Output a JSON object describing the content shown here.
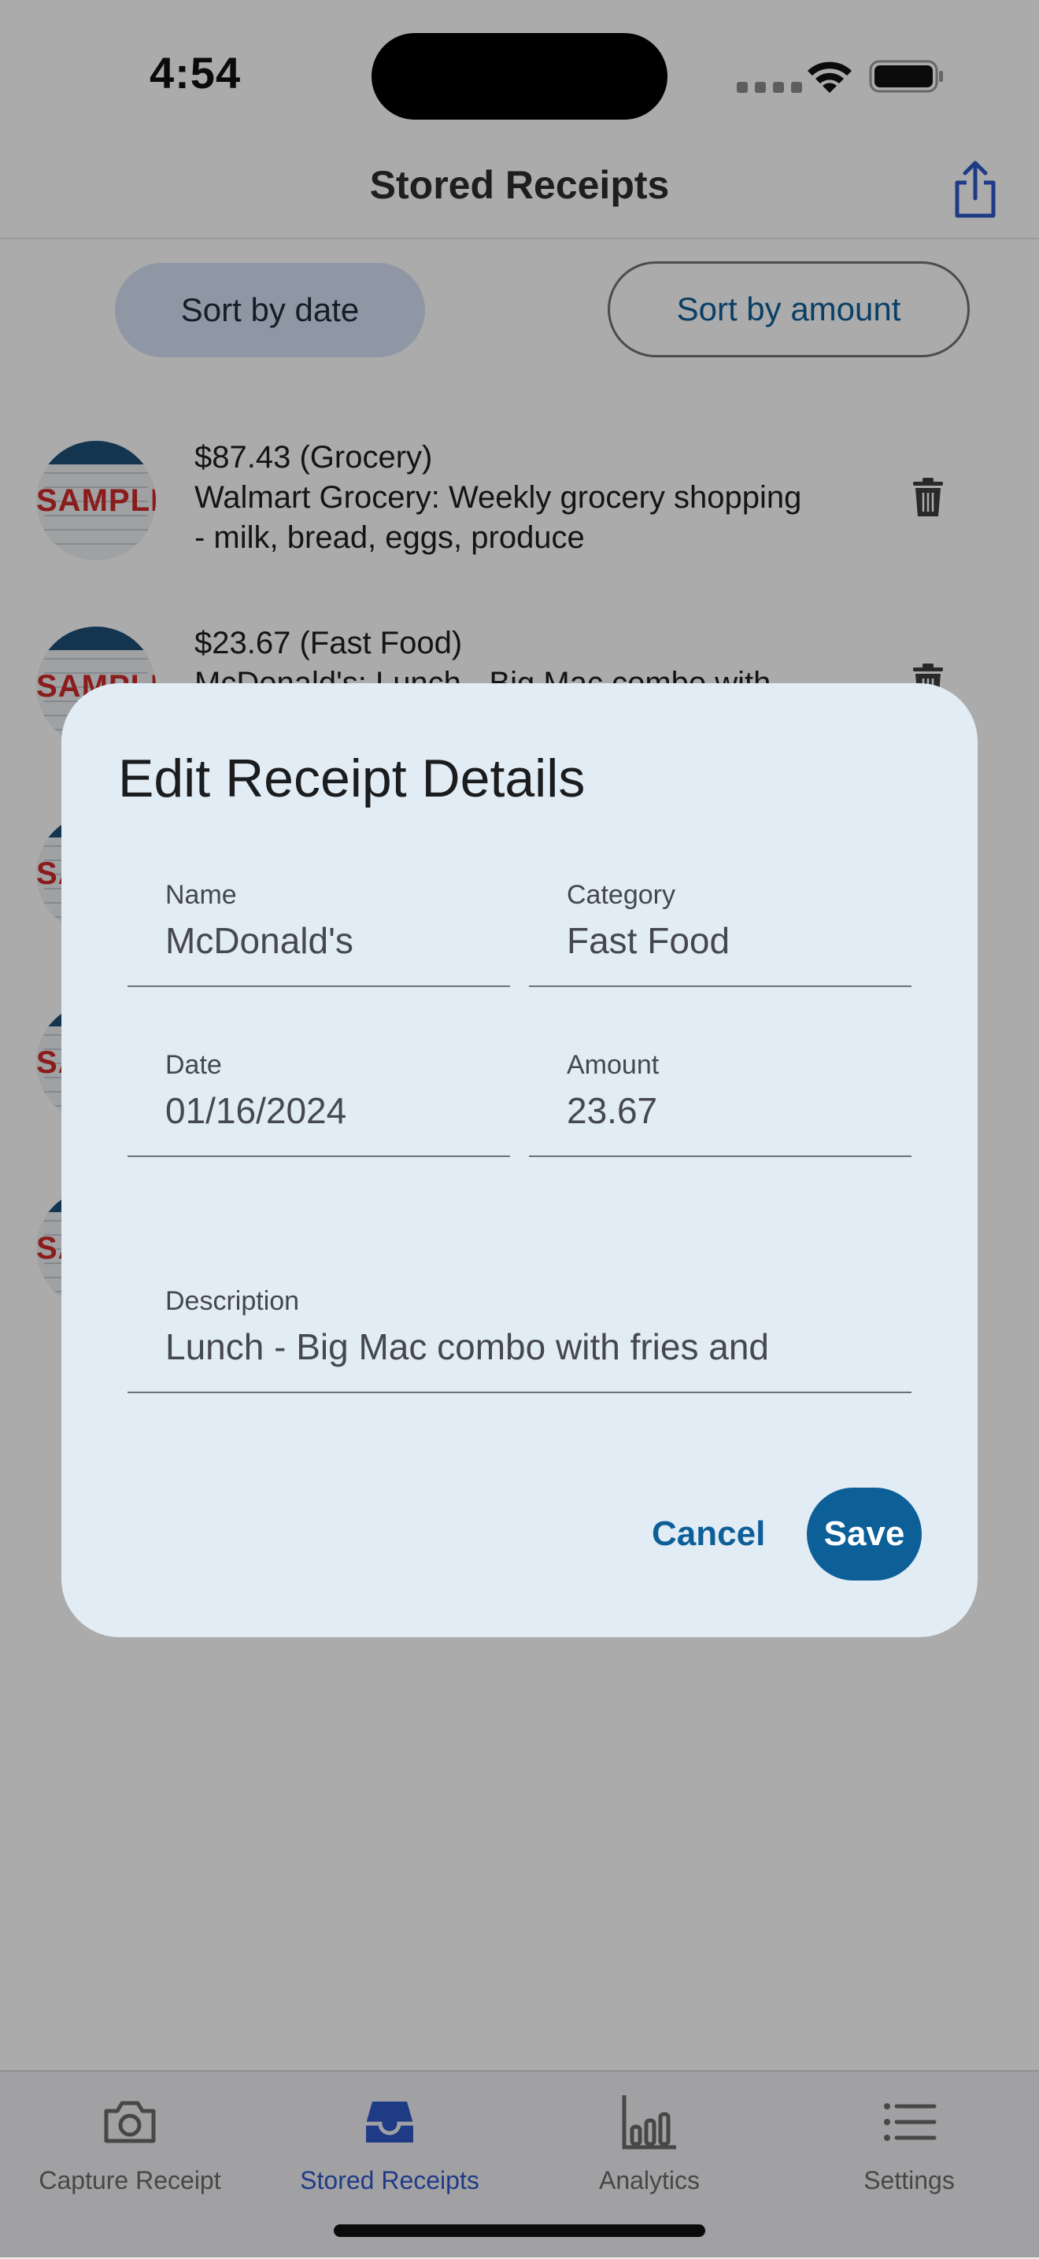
{
  "status_bar": {
    "time": "4:54"
  },
  "header": {
    "title": "Stored Receipts"
  },
  "sort": {
    "by_date_label": "Sort by date",
    "by_amount_label": "Sort by amount"
  },
  "receipts": [
    {
      "stamp": "SAMPLE",
      "line1": "$87.43 (Grocery)",
      "line2": "Walmart Grocery: Weekly grocery shopping",
      "line3": "- milk, bread, eggs, produce"
    },
    {
      "stamp": "SAMPLE",
      "line1": "$23.67 (Fast Food)",
      "line2": "McDonald's: Lunch - Big Mac combo with"
    },
    {
      "stamp": "SAMPLE"
    },
    {
      "stamp": "SAMPLE"
    },
    {
      "stamp": "SAMPLE"
    }
  ],
  "dialog": {
    "title": "Edit Receipt Details",
    "name_label": "Name",
    "name_value": "McDonald's",
    "category_label": "Category",
    "category_value": "Fast Food",
    "date_label": "Date",
    "date_value": "01/16/2024",
    "amount_label": "Amount",
    "amount_value": "23.67",
    "description_label": "Description",
    "description_value": "Lunch - Big Mac combo with fries and",
    "cancel_label": "Cancel",
    "save_label": "Save"
  },
  "nav": {
    "items": [
      {
        "label": "Capture Receipt",
        "icon": "camera-icon"
      },
      {
        "label": "Stored Receipts",
        "icon": "inbox-icon",
        "active": true
      },
      {
        "label": "Analytics",
        "icon": "bar-chart-icon"
      },
      {
        "label": "Settings",
        "icon": "list-icon"
      }
    ]
  },
  "colors": {
    "accent_blue": "#0d5f98",
    "nav_active": "#2f59c8",
    "dialog_bg": "#e2ecf5",
    "sort_active_bg": "#d5e2f6"
  }
}
